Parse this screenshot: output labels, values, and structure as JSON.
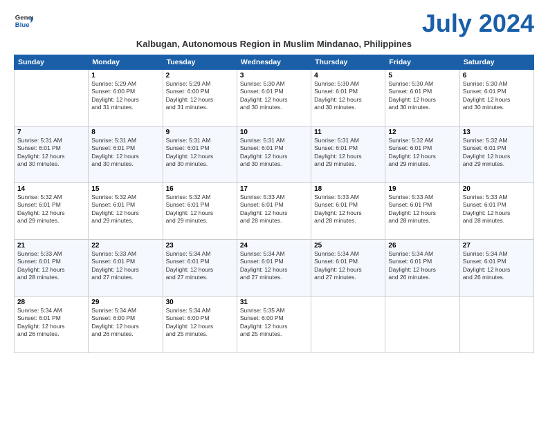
{
  "logo": {
    "line1": "General",
    "line2": "Blue"
  },
  "title": "July 2024",
  "subtitle": "Kalbugan, Autonomous Region in Muslim Mindanao, Philippines",
  "days_of_week": [
    "Sunday",
    "Monday",
    "Tuesday",
    "Wednesday",
    "Thursday",
    "Friday",
    "Saturday"
  ],
  "weeks": [
    [
      {
        "day": "",
        "info": ""
      },
      {
        "day": "1",
        "info": "Sunrise: 5:29 AM\nSunset: 6:00 PM\nDaylight: 12 hours\nand 31 minutes."
      },
      {
        "day": "2",
        "info": "Sunrise: 5:29 AM\nSunset: 6:00 PM\nDaylight: 12 hours\nand 31 minutes."
      },
      {
        "day": "3",
        "info": "Sunrise: 5:30 AM\nSunset: 6:01 PM\nDaylight: 12 hours\nand 30 minutes."
      },
      {
        "day": "4",
        "info": "Sunrise: 5:30 AM\nSunset: 6:01 PM\nDaylight: 12 hours\nand 30 minutes."
      },
      {
        "day": "5",
        "info": "Sunrise: 5:30 AM\nSunset: 6:01 PM\nDaylight: 12 hours\nand 30 minutes."
      },
      {
        "day": "6",
        "info": "Sunrise: 5:30 AM\nSunset: 6:01 PM\nDaylight: 12 hours\nand 30 minutes."
      }
    ],
    [
      {
        "day": "7",
        "info": "Sunrise: 5:31 AM\nSunset: 6:01 PM\nDaylight: 12 hours\nand 30 minutes."
      },
      {
        "day": "8",
        "info": "Sunrise: 5:31 AM\nSunset: 6:01 PM\nDaylight: 12 hours\nand 30 minutes."
      },
      {
        "day": "9",
        "info": "Sunrise: 5:31 AM\nSunset: 6:01 PM\nDaylight: 12 hours\nand 30 minutes."
      },
      {
        "day": "10",
        "info": "Sunrise: 5:31 AM\nSunset: 6:01 PM\nDaylight: 12 hours\nand 30 minutes."
      },
      {
        "day": "11",
        "info": "Sunrise: 5:31 AM\nSunset: 6:01 PM\nDaylight: 12 hours\nand 29 minutes."
      },
      {
        "day": "12",
        "info": "Sunrise: 5:32 AM\nSunset: 6:01 PM\nDaylight: 12 hours\nand 29 minutes."
      },
      {
        "day": "13",
        "info": "Sunrise: 5:32 AM\nSunset: 6:01 PM\nDaylight: 12 hours\nand 29 minutes."
      }
    ],
    [
      {
        "day": "14",
        "info": "Sunrise: 5:32 AM\nSunset: 6:01 PM\nDaylight: 12 hours\nand 29 minutes."
      },
      {
        "day": "15",
        "info": "Sunrise: 5:32 AM\nSunset: 6:01 PM\nDaylight: 12 hours\nand 29 minutes."
      },
      {
        "day": "16",
        "info": "Sunrise: 5:32 AM\nSunset: 6:01 PM\nDaylight: 12 hours\nand 29 minutes."
      },
      {
        "day": "17",
        "info": "Sunrise: 5:33 AM\nSunset: 6:01 PM\nDaylight: 12 hours\nand 28 minutes."
      },
      {
        "day": "18",
        "info": "Sunrise: 5:33 AM\nSunset: 6:01 PM\nDaylight: 12 hours\nand 28 minutes."
      },
      {
        "day": "19",
        "info": "Sunrise: 5:33 AM\nSunset: 6:01 PM\nDaylight: 12 hours\nand 28 minutes."
      },
      {
        "day": "20",
        "info": "Sunrise: 5:33 AM\nSunset: 6:01 PM\nDaylight: 12 hours\nand 28 minutes."
      }
    ],
    [
      {
        "day": "21",
        "info": "Sunrise: 5:33 AM\nSunset: 6:01 PM\nDaylight: 12 hours\nand 28 minutes."
      },
      {
        "day": "22",
        "info": "Sunrise: 5:33 AM\nSunset: 6:01 PM\nDaylight: 12 hours\nand 27 minutes."
      },
      {
        "day": "23",
        "info": "Sunrise: 5:34 AM\nSunset: 6:01 PM\nDaylight: 12 hours\nand 27 minutes."
      },
      {
        "day": "24",
        "info": "Sunrise: 5:34 AM\nSunset: 6:01 PM\nDaylight: 12 hours\nand 27 minutes."
      },
      {
        "day": "25",
        "info": "Sunrise: 5:34 AM\nSunset: 6:01 PM\nDaylight: 12 hours\nand 27 minutes."
      },
      {
        "day": "26",
        "info": "Sunrise: 5:34 AM\nSunset: 6:01 PM\nDaylight: 12 hours\nand 26 minutes."
      },
      {
        "day": "27",
        "info": "Sunrise: 5:34 AM\nSunset: 6:01 PM\nDaylight: 12 hours\nand 26 minutes."
      }
    ],
    [
      {
        "day": "28",
        "info": "Sunrise: 5:34 AM\nSunset: 6:01 PM\nDaylight: 12 hours\nand 26 minutes."
      },
      {
        "day": "29",
        "info": "Sunrise: 5:34 AM\nSunset: 6:00 PM\nDaylight: 12 hours\nand 26 minutes."
      },
      {
        "day": "30",
        "info": "Sunrise: 5:34 AM\nSunset: 6:00 PM\nDaylight: 12 hours\nand 25 minutes."
      },
      {
        "day": "31",
        "info": "Sunrise: 5:35 AM\nSunset: 6:00 PM\nDaylight: 12 hours\nand 25 minutes."
      },
      {
        "day": "",
        "info": ""
      },
      {
        "day": "",
        "info": ""
      },
      {
        "day": "",
        "info": ""
      }
    ]
  ]
}
